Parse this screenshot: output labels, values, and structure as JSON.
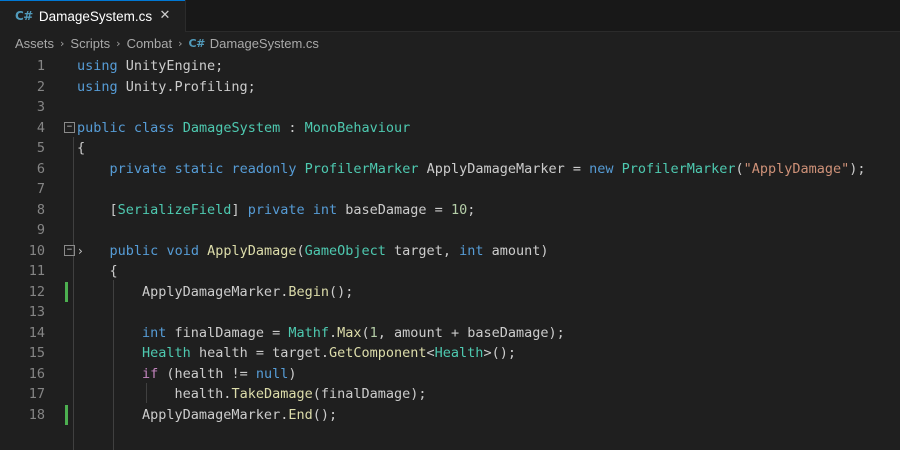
{
  "tab": {
    "badge": "C#",
    "title": "DamageSystem.cs",
    "close_glyph": "✕"
  },
  "breadcrumb": {
    "items": [
      "Assets",
      "Scripts",
      "Combat"
    ],
    "file_badge": "C#",
    "file": "DamageSystem.cs",
    "separator": "›"
  },
  "editor": {
    "fold_glyph": "−",
    "chevron_glyph": "›",
    "modified_lines": [
      12,
      18
    ],
    "line_numbers": [
      "1",
      "2",
      "3",
      "4",
      "5",
      "6",
      "7",
      "8",
      "9",
      "10",
      "11",
      "12",
      "13",
      "14",
      "15",
      "16",
      "17",
      "18"
    ],
    "lines": [
      [
        {
          "t": "using",
          "c": "kw"
        },
        {
          "t": " UnityEngine;",
          "c": "plain"
        }
      ],
      [
        {
          "t": "using",
          "c": "kw"
        },
        {
          "t": " Unity.Profiling;",
          "c": "plain"
        }
      ],
      [],
      [
        {
          "t": "public",
          "c": "kw"
        },
        {
          "t": " ",
          "c": "plain"
        },
        {
          "t": "class",
          "c": "kw"
        },
        {
          "t": " ",
          "c": "plain"
        },
        {
          "t": "DamageSystem",
          "c": "ty"
        },
        {
          "t": " : ",
          "c": "plain"
        },
        {
          "t": "MonoBehaviour",
          "c": "ty"
        }
      ],
      [
        {
          "t": "{",
          "c": "plain"
        }
      ],
      [
        {
          "t": "    ",
          "c": "plain"
        },
        {
          "t": "private",
          "c": "kw"
        },
        {
          "t": " ",
          "c": "plain"
        },
        {
          "t": "static",
          "c": "kw"
        },
        {
          "t": " ",
          "c": "plain"
        },
        {
          "t": "readonly",
          "c": "kw"
        },
        {
          "t": " ",
          "c": "plain"
        },
        {
          "t": "ProfilerMarker",
          "c": "ty"
        },
        {
          "t": " ApplyDamageMarker = ",
          "c": "plain"
        },
        {
          "t": "new",
          "c": "kw"
        },
        {
          "t": " ",
          "c": "plain"
        },
        {
          "t": "ProfilerMarker",
          "c": "ty"
        },
        {
          "t": "(",
          "c": "plain"
        },
        {
          "t": "\"ApplyDamage\"",
          "c": "str"
        },
        {
          "t": ");",
          "c": "plain"
        }
      ],
      [],
      [
        {
          "t": "    [",
          "c": "plain"
        },
        {
          "t": "SerializeField",
          "c": "ty"
        },
        {
          "t": "] ",
          "c": "plain"
        },
        {
          "t": "private",
          "c": "kw"
        },
        {
          "t": " ",
          "c": "plain"
        },
        {
          "t": "int",
          "c": "kw"
        },
        {
          "t": " baseDamage = ",
          "c": "plain"
        },
        {
          "t": "10",
          "c": "num"
        },
        {
          "t": ";",
          "c": "plain"
        }
      ],
      [],
      [
        {
          "t": "    ",
          "c": "plain"
        },
        {
          "t": "public",
          "c": "kw"
        },
        {
          "t": " ",
          "c": "plain"
        },
        {
          "t": "void",
          "c": "kw"
        },
        {
          "t": " ",
          "c": "plain"
        },
        {
          "t": "ApplyDamage",
          "c": "fn"
        },
        {
          "t": "(",
          "c": "plain"
        },
        {
          "t": "GameObject",
          "c": "ty"
        },
        {
          "t": " target, ",
          "c": "plain"
        },
        {
          "t": "int",
          "c": "kw"
        },
        {
          "t": " amount)",
          "c": "plain"
        }
      ],
      [
        {
          "t": "    {",
          "c": "plain"
        }
      ],
      [
        {
          "t": "        ApplyDamageMarker.",
          "c": "plain"
        },
        {
          "t": "Begin",
          "c": "fn"
        },
        {
          "t": "();",
          "c": "plain"
        }
      ],
      [],
      [
        {
          "t": "        ",
          "c": "plain"
        },
        {
          "t": "int",
          "c": "kw"
        },
        {
          "t": " finalDamage = ",
          "c": "plain"
        },
        {
          "t": "Mathf",
          "c": "ty"
        },
        {
          "t": ".",
          "c": "plain"
        },
        {
          "t": "Max",
          "c": "fn"
        },
        {
          "t": "(",
          "c": "plain"
        },
        {
          "t": "1",
          "c": "num"
        },
        {
          "t": ", amount + baseDamage);",
          "c": "plain"
        }
      ],
      [
        {
          "t": "        ",
          "c": "plain"
        },
        {
          "t": "Health",
          "c": "ty"
        },
        {
          "t": " health = target.",
          "c": "plain"
        },
        {
          "t": "GetComponent",
          "c": "fn"
        },
        {
          "t": "<",
          "c": "plain"
        },
        {
          "t": "Health",
          "c": "ty"
        },
        {
          "t": ">();",
          "c": "plain"
        }
      ],
      [
        {
          "t": "        ",
          "c": "plain"
        },
        {
          "t": "if",
          "c": "ctl"
        },
        {
          "t": " (health != ",
          "c": "plain"
        },
        {
          "t": "null",
          "c": "kw"
        },
        {
          "t": ")",
          "c": "plain"
        }
      ],
      [
        {
          "t": "            health.",
          "c": "plain"
        },
        {
          "t": "TakeDamage",
          "c": "fn"
        },
        {
          "t": "(finalDamage);",
          "c": "plain"
        }
      ],
      [
        {
          "t": "        ApplyDamageMarker.",
          "c": "plain"
        },
        {
          "t": "End",
          "c": "fn"
        },
        {
          "t": "();",
          "c": "plain"
        }
      ]
    ]
  }
}
